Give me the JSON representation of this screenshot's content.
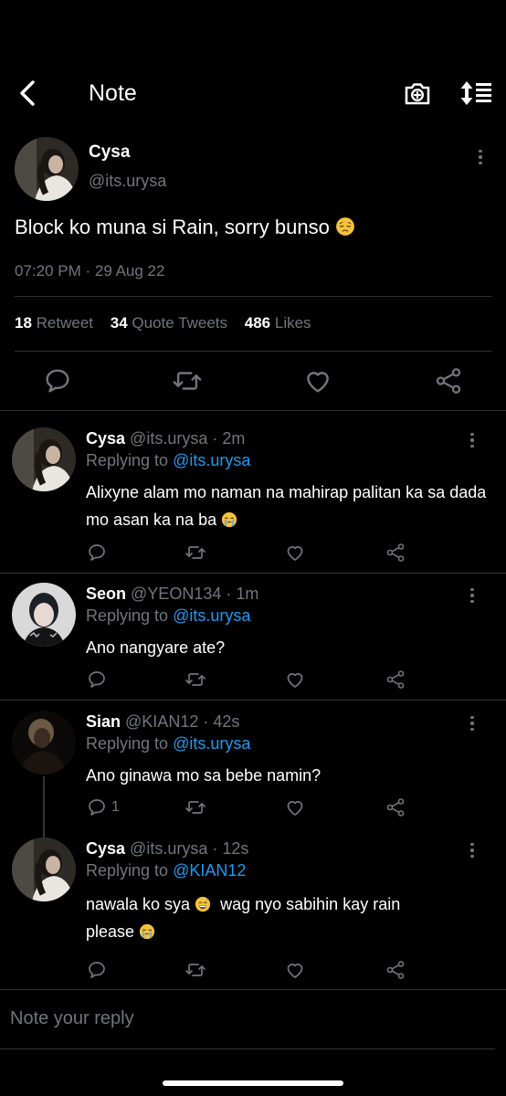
{
  "header": {
    "title": "Note"
  },
  "main_post": {
    "name": "Cysa",
    "handle": "@its.urysa",
    "text": "Block ko muna si Rain, sorry bunso",
    "text_emoji": "pensive-face",
    "timestamp": "07:20 PM · 29 Aug 22",
    "stats": {
      "retweets_count": "18",
      "retweets_label": "Retweet",
      "quotes_count": "34",
      "quotes_label": "Quote Tweets",
      "likes_count": "486",
      "likes_label": "Likes"
    }
  },
  "replies": [
    {
      "name": "Cysa",
      "handle": "@its.urysa",
      "sep": " · ",
      "time": "2m",
      "replying_prefix": "Replying to",
      "replying_to": "@its.urysa",
      "text": "Alixyne alam mo naman na mahirap palitan ka sa dada mo asan ka na ba",
      "emoji": "loudly-crying-face",
      "reply_count": ""
    },
    {
      "name": "Seon",
      "handle": "@YEON134",
      "sep": " · ",
      "time": "1m",
      "replying_prefix": "Replying to",
      "replying_to": "@its.urysa",
      "text": "Ano nangyare ate?",
      "reply_count": ""
    },
    {
      "name": "Sian",
      "handle": "@KIAN12",
      "sep": " · ",
      "time": "42s",
      "replying_prefix": "Replying to",
      "replying_to": "@its.urysa",
      "text": "Ano ginawa mo sa bebe namin?",
      "reply_count": "1"
    },
    {
      "name": "Cysa",
      "handle": "@its.urysa",
      "sep": " · ",
      "time": "12s",
      "replying_prefix": "Replying to",
      "replying_to": "@KIAN12",
      "text_part1": "nawala ko sya",
      "emoji1": "grinning-sweat-face",
      "text_part2": "wag nyo sabihin kay rain please",
      "emoji2": "loudly-crying-face",
      "reply_count": ""
    }
  ],
  "compose": {
    "placeholder": "Note your reply"
  },
  "icons": {
    "back": "chevron-left-icon",
    "camera": "camera-plus-icon",
    "sort": "sort-icon",
    "more": "more-vertical-icon",
    "reply": "comment-icon",
    "retweet": "retweet-icon",
    "like": "heart-icon",
    "share": "share-icon"
  },
  "colors": {
    "background": "#000000",
    "text": "#e7e9ea",
    "muted": "#71767b",
    "link": "#1d9bf0",
    "divider": "#2f3336"
  }
}
